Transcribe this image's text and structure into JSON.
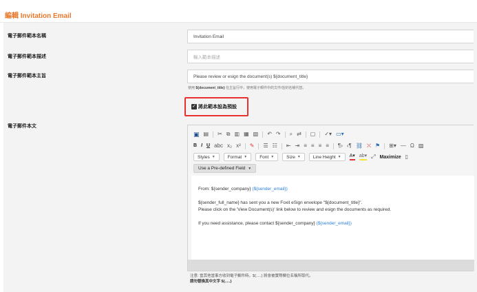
{
  "page": {
    "title": "編輯 Invitation Email"
  },
  "form": {
    "name_label": "電子郵件範本名稱",
    "name_value": "Invitation Email",
    "desc_label": "電子郵件範本描述",
    "desc_placeholder": "輸入範本描述",
    "subject_label": "電子郵件範本主旨",
    "subject_value": "Please review or esign the document(s) ${document_title}",
    "subject_hint_prefix": "使用",
    "subject_hint_var": "${document_title}",
    "subject_hint_suffix": "在主旨行中，使用電子郵件中的文件/信封名稱代替。",
    "default_label": "將此範本設為預設",
    "default_checked": true,
    "body_label": "電子郵件本文"
  },
  "editor": {
    "toolbar": {
      "styles": "Styles",
      "format": "Format",
      "font": "Font",
      "size": "Size",
      "line_height": "Line Height",
      "maximize": "Maximize",
      "predefined": "Use a Pre-defined Field"
    },
    "content": {
      "from_prefix": "From: ${sender_company}",
      "from_link": "(${sender_email})",
      "line2": "${sender_full_name} has sent you a new Foxit eSign envelope \"${document_title}\".",
      "line3": "Please click on the 'View Document(s)' link below to review and esign the documents as required.",
      "line4_prefix": "If you need assistance, please contact ${sender_company}",
      "line4_link": "(${sender_email})"
    }
  },
  "notes": {
    "line1": "注意: 當其他當事方收到電子郵件時，${.....} 將會被實際欄位名稱所取代。",
    "line2": "請勿替換其中文字 ${.....}"
  },
  "colors": {
    "accent": "#e8792b",
    "highlight_border": "#e8312f",
    "link": "#2a7ee0"
  }
}
